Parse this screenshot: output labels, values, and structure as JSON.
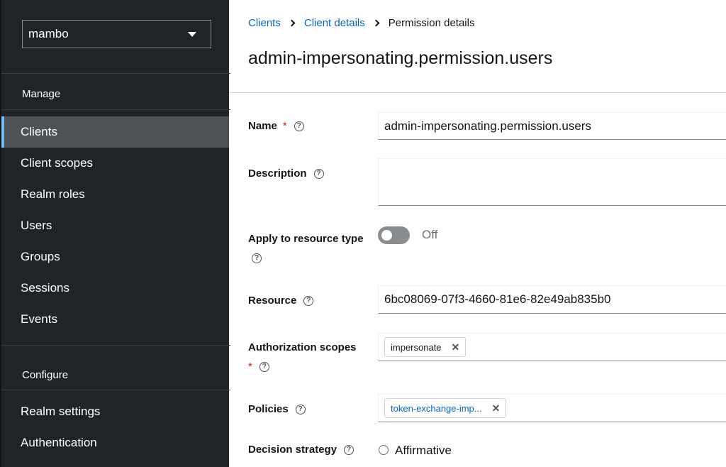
{
  "sidebar": {
    "realm": "mambo",
    "groups": [
      {
        "title": "Manage"
      },
      {
        "title": "Configure"
      }
    ],
    "items": [
      {
        "label": "Clients",
        "active": true
      },
      {
        "label": "Client scopes"
      },
      {
        "label": "Realm roles"
      },
      {
        "label": "Users"
      },
      {
        "label": "Groups"
      },
      {
        "label": "Sessions"
      },
      {
        "label": "Events"
      },
      {
        "label": "Realm settings"
      },
      {
        "label": "Authentication"
      }
    ]
  },
  "breadcrumb": [
    "Clients",
    "Client details",
    "Permission details"
  ],
  "page_title": "admin-impersonating.permission.users",
  "form": {
    "name": {
      "label": "Name",
      "required": "*",
      "value": "admin-impersonating.permission.users"
    },
    "description": {
      "label": "Description",
      "value": ""
    },
    "apply_resource_type": {
      "label": "Apply to resource type",
      "state": "Off"
    },
    "resource": {
      "label": "Resource",
      "value": "6bc08069-07f3-4660-81e6-82e49ab835b0"
    },
    "authorization_scopes": {
      "label": "Authorization scopes",
      "required": "*",
      "chips": [
        "impersonate"
      ]
    },
    "policies": {
      "label": "Policies",
      "chips": [
        "token-exchange-imp..."
      ]
    },
    "decision_strategy": {
      "label": "Decision strategy",
      "options": [
        "Affirmative"
      ]
    }
  },
  "help_glyph": "?",
  "remove_glyph": "✕",
  "colors": {
    "sidebar_bg": "#212427",
    "active_bg": "#4f5255",
    "active_indicator": "#73bcf7",
    "link": "#0066cc",
    "required": "#c9190b"
  }
}
